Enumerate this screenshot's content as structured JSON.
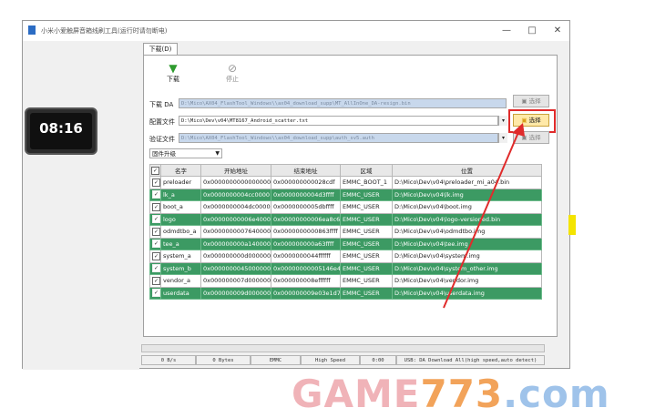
{
  "window": {
    "title": "小米小爱触屏音箱线刷工具(运行时请勿断电)",
    "minimize": "—",
    "maximize": "□",
    "close": "✕"
  },
  "device": {
    "time": "08:16",
    "date": ""
  },
  "tab": {
    "label": "下载(D)"
  },
  "toolbar": {
    "download_label": "下载",
    "stop_label": "停止"
  },
  "download_agent": {
    "label": "下载 DA",
    "path": "D:\\Mico\\AX04_FlashTool_Windows\\\\ax04_download_supp\\MT_AllInOne_DA-resign.bin",
    "button": "选择"
  },
  "scatter": {
    "label": "配置文件",
    "path": "D:\\Mico\\Dev\\v04\\MT8167_Android_scatter.txt",
    "button": "选择"
  },
  "auth": {
    "label": "验证文件",
    "path": "D:\\Mico\\AX04_FlashTool_Windows\\\\ax04_download_supp\\auth_sv5.auth",
    "button": "选择"
  },
  "mode_select": {
    "value": "固件升级"
  },
  "table": {
    "headers": [
      "",
      "名字",
      "开始地址",
      "结束地址",
      "区域",
      "位置"
    ],
    "rows": [
      {
        "name": "preloader",
        "start": "0x0000000000000000",
        "end": "0x000000000028cdf",
        "region": "EMMC_BOOT_1",
        "location": "D:\\Mico\\Dev\\v04\\preloader_mi_a04.bin"
      },
      {
        "name": "lk_a",
        "start": "0x0000000004cc0000",
        "end": "0x0000000004d3ffff",
        "region": "EMMC_USER",
        "location": "D:\\Mico\\Dev\\v04\\lk.img"
      },
      {
        "name": "boot_a",
        "start": "0x0000000004dc0000",
        "end": "0x0000000005dbffff",
        "region": "EMMC_USER",
        "location": "D:\\Mico\\Dev\\v04\\boot.img"
      },
      {
        "name": "logo",
        "start": "0x00000000006e40000",
        "end": "0x00000000006ea8c6f",
        "region": "EMMC_USER",
        "location": "D:\\Mico\\Dev\\v04\\logo-versioned.bin"
      },
      {
        "name": "odmdtbo_a",
        "start": "0x0000000007640000",
        "end": "0x0000000000863ffff",
        "region": "EMMC_USER",
        "location": "D:\\Mico\\Dev\\v04\\odmdtbo.img"
      },
      {
        "name": "tee_a",
        "start": "0x000000000a140000",
        "end": "0x000000000a63ffff",
        "region": "EMMC_USER",
        "location": "D:\\Mico\\Dev\\v04\\tee.img"
      },
      {
        "name": "system_a",
        "start": "0x000000000d000000",
        "end": "0x0000000044ffffff",
        "region": "EMMC_USER",
        "location": "D:\\Mico\\Dev\\v04\\system.img"
      },
      {
        "name": "system_b",
        "start": "0x0000000045000000",
        "end": "0x00000000005146e407",
        "region": "EMMC_USER",
        "location": "D:\\Mico\\Dev\\v04\\system_other.img"
      },
      {
        "name": "vendor_a",
        "start": "0x000000007d000000",
        "end": "0x000000008effffff",
        "region": "EMMC_USER",
        "location": "D:\\Mico\\Dev\\v04\\vendor.img"
      },
      {
        "name": "userdata",
        "start": "0x000000009d000000",
        "end": "0x000000009e03e1d7",
        "region": "EMMC_USER",
        "location": "D:\\Mico\\Dev\\v04\\userdata.img"
      }
    ]
  },
  "statusbar": {
    "speed": "0 B/s",
    "bytes": "0 Bytes",
    "storage": "EMMC",
    "usb_speed": "High Speed",
    "time": "0:00",
    "message": "USB: DA Download All(high speed,auto detect)"
  },
  "watermark": {
    "part1": "GAME",
    "part2": "773",
    "part3": ".com"
  },
  "colors": {
    "row_highlight": "#3c9a63",
    "annotation_red": "#e02b2b"
  }
}
